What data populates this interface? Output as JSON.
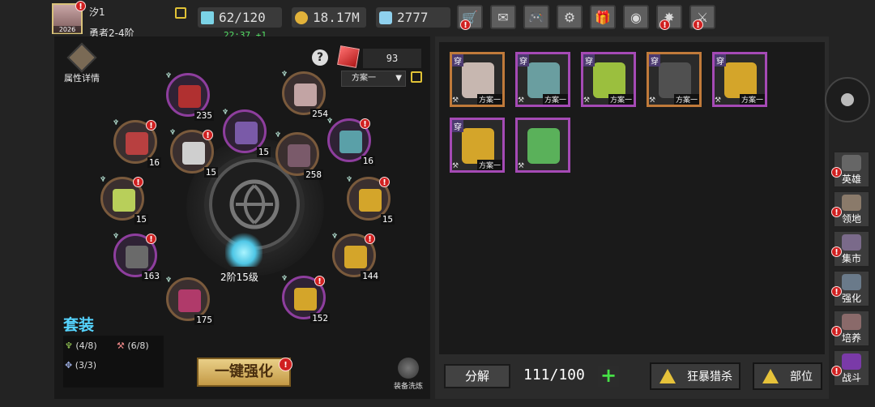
{
  "player": {
    "name": "汐1",
    "rank": "勇者2-4阶",
    "avatar_badge": "2026"
  },
  "resources": {
    "stamina": "62/120",
    "stamina_timer": "22:37 +1",
    "gold": "18.17M",
    "diamond": "2777"
  },
  "toolbar": [
    {
      "name": "shop-button",
      "icon": "cart-icon",
      "glyph": "🛒",
      "badge": true
    },
    {
      "name": "mail-button",
      "icon": "mail-icon",
      "glyph": "✉",
      "badge": false
    },
    {
      "name": "gamepad-button",
      "icon": "gamepad-icon",
      "glyph": "🎮",
      "badge": false
    },
    {
      "name": "settings-button",
      "icon": "gear-icon",
      "glyph": "⚙",
      "badge": false
    },
    {
      "name": "gift-button",
      "icon": "gift-icon",
      "glyph": "🎁",
      "badge": false
    },
    {
      "name": "wheel-button",
      "icon": "color-wheel-icon",
      "glyph": "◉",
      "badge": false
    },
    {
      "name": "event-button",
      "icon": "firework-icon",
      "glyph": "✸",
      "badge": true
    },
    {
      "name": "battle-button",
      "icon": "crossed-swords-icon",
      "glyph": "⚔",
      "badge": true
    }
  ],
  "left_panel": {
    "attr_label": "属性详情",
    "gem_count": "93",
    "scheme": "方案一",
    "center_slot_label": "2阶15级",
    "set_title": "套装",
    "set_lines": [
      "(4/8)",
      "(6/8)",
      "(3/3)"
    ],
    "strengthen_label": "一键强化",
    "refine_label": "装备洗炼",
    "slots": [
      {
        "count": "235",
        "badge": false
      },
      {
        "count": "254",
        "badge": false
      },
      {
        "count": "16",
        "badge": true
      },
      {
        "count": "15",
        "badge": false
      },
      {
        "count": "15",
        "badge": true
      },
      {
        "count": "258",
        "badge": false
      },
      {
        "count": "16",
        "badge": true
      },
      {
        "count": "15",
        "badge": true
      },
      {
        "count": "15",
        "badge": true
      },
      {
        "count": "163",
        "badge": true
      },
      {
        "count": "144",
        "badge": true
      },
      {
        "count": "175",
        "badge": false
      },
      {
        "count": "152",
        "badge": true
      }
    ]
  },
  "inventory": {
    "items": [
      {
        "wear": "穿",
        "plan": "方案一",
        "rarity": "orange",
        "art": "#c7b7b0"
      },
      {
        "wear": "穿",
        "plan": "方案一",
        "rarity": "purple",
        "art": "#6a9ea0"
      },
      {
        "wear": "穿",
        "plan": "方案一",
        "rarity": "purple",
        "art": "#9bbf3e"
      },
      {
        "wear": "穿",
        "plan": "方案一",
        "rarity": "orange",
        "art": "#505050"
      },
      {
        "wear": "穿",
        "plan": "方案一",
        "rarity": "purple",
        "art": "#d4a52a"
      },
      {
        "wear": "穿",
        "plan": "方案一",
        "rarity": "purple",
        "art": "#d4a52a"
      },
      {
        "wear": "",
        "plan": "",
        "rarity": "purple",
        "art": "#5ab15a"
      }
    ],
    "decompose_label": "分解",
    "capacity": "111/100",
    "filter_1": "狂暴猎杀",
    "filter_2": "部位"
  },
  "sidebar": [
    {
      "label": "英雄",
      "icon": "helmet-icon",
      "badge": true
    },
    {
      "label": "领地",
      "icon": "castle-icon",
      "badge": true
    },
    {
      "label": "集市",
      "icon": "merchant-icon",
      "badge": true
    },
    {
      "label": "强化",
      "icon": "anvil-icon",
      "badge": true
    },
    {
      "label": "培养",
      "icon": "potion-icon",
      "badge": true
    },
    {
      "label": "战斗",
      "icon": "portal-icon",
      "badge": true
    }
  ]
}
